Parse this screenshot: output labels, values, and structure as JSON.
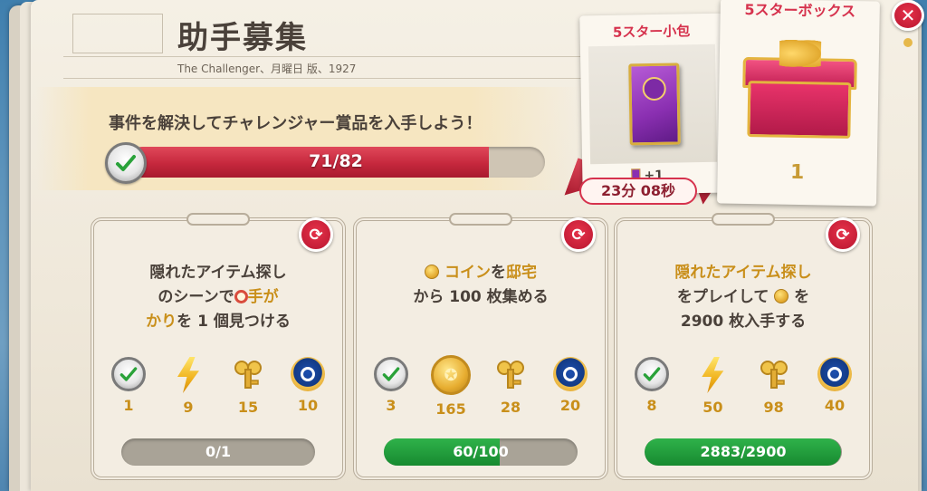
{
  "header": {
    "title": "助手募集",
    "subtitle": "The Challenger、月曜日 版、1927"
  },
  "challenge": {
    "description": "事件を解決してチャレンジャー賞品を入手しよう！",
    "progress_label": "71/82",
    "progress_current": 71,
    "progress_total": 82
  },
  "rewards": {
    "pack": {
      "title": "5スター小包",
      "bonus": "+1",
      "timer": "23分 08秒"
    },
    "box": {
      "title": "5スターボックス",
      "count": "1"
    }
  },
  "tasks": [
    {
      "line1": "隠れたアイテム探し",
      "line2_pre": "のシーンで",
      "line2_hl": "手が",
      "line3_hl": "かり",
      "line3_post": "を 1 個見つける",
      "rewards": [
        "1",
        "9",
        "15",
        "10"
      ],
      "progress_label": "0/1",
      "progress_fraction": 0.0
    },
    {
      "line1_hl_a": "コイン",
      "line1_mid": "を",
      "line1_hl_b": "邸宅",
      "line2": "から 100 枚集める",
      "rewards": [
        "3",
        "165",
        "28",
        "20"
      ],
      "progress_label": "60/100",
      "progress_fraction": 0.6
    },
    {
      "line1_hl": "隠れたアイテム探し",
      "line2_pre": "をプレイして",
      "line2_post": "を",
      "line3": "2900 枚入手する",
      "rewards": [
        "8",
        "50",
        "98",
        "40"
      ],
      "progress_label": "2883/2900",
      "progress_fraction": 0.994
    }
  ],
  "colors": {
    "accent_red": "#c6283d",
    "progress_green": "#178a30",
    "gold_text": "#c98f1a"
  },
  "icons": [
    "check-badge-icon",
    "lightning-icon",
    "wind-up-key-icon",
    "magnifier-medal-icon",
    "coin-icon",
    "refresh-icon",
    "close-icon"
  ]
}
